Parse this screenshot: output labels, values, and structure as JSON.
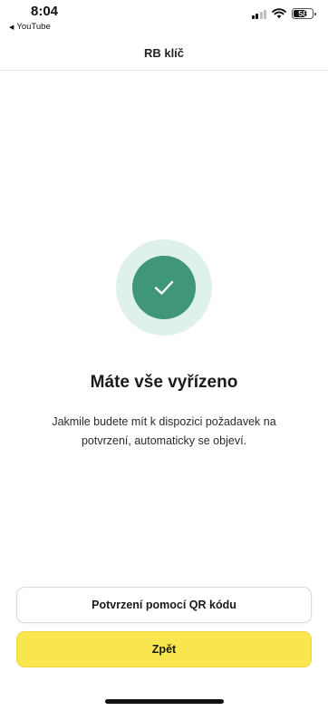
{
  "status_bar": {
    "time": "8:04",
    "back_app": "YouTube",
    "battery": "58",
    "signal_icon": "cellular-signal-icon",
    "wifi_icon": "wifi-icon"
  },
  "header": {
    "title": "RB klíč"
  },
  "main": {
    "icon": "checkmark-icon",
    "accent_color": "#3f9678",
    "heading": "Máte vše vyřízeno",
    "description": "Jakmile budete mít k dispozici požadavek na potvrzení, automaticky se objeví."
  },
  "actions": {
    "qr_label": "Potvrzení pomocí QR kódu",
    "back_label": "Zpět",
    "primary_color": "#f9e64e"
  }
}
